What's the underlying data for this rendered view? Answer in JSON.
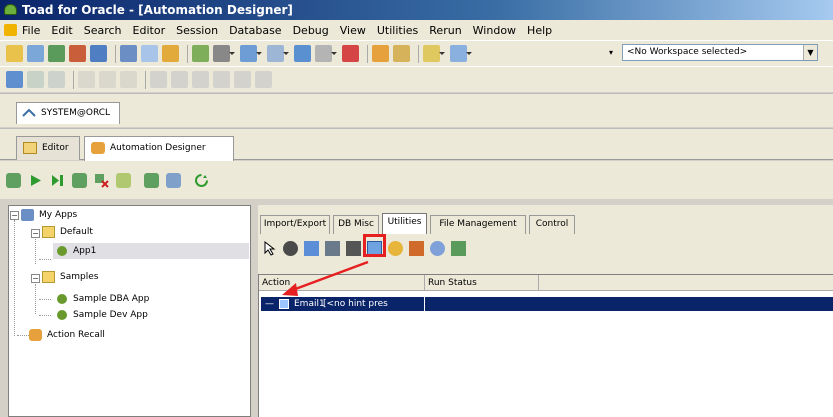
{
  "window": {
    "title": "Toad for Oracle - [Automation Designer]"
  },
  "menu": [
    "File",
    "Edit",
    "Search",
    "Editor",
    "Session",
    "Database",
    "Debug",
    "View",
    "Utilities",
    "Rerun",
    "Window",
    "Help"
  ],
  "workspace": {
    "selected": "<No Workspace selected>"
  },
  "connection_tab": "SYSTEM@ORCL",
  "document_tabs": [
    "Editor",
    "Automation Designer"
  ],
  "tree": {
    "root": "My Apps",
    "default_group": "Default",
    "app1": "App1",
    "samples_group": "Samples",
    "sample_dba": "Sample DBA App",
    "sample_dev": "Sample Dev App",
    "action_recall": "Action Recall"
  },
  "subtabs": [
    "Import/Export",
    "DB Misc",
    "Utilities",
    "File Management",
    "Control"
  ],
  "grid": {
    "headers": [
      "Action",
      "Run Status"
    ],
    "rows": [
      {
        "name": "Email1",
        "hint": "[<no hint pres"
      }
    ]
  },
  "colors": {
    "selection": "#0a246a",
    "highlight": "#e62020",
    "title_gradient_start": "#0a246a"
  }
}
